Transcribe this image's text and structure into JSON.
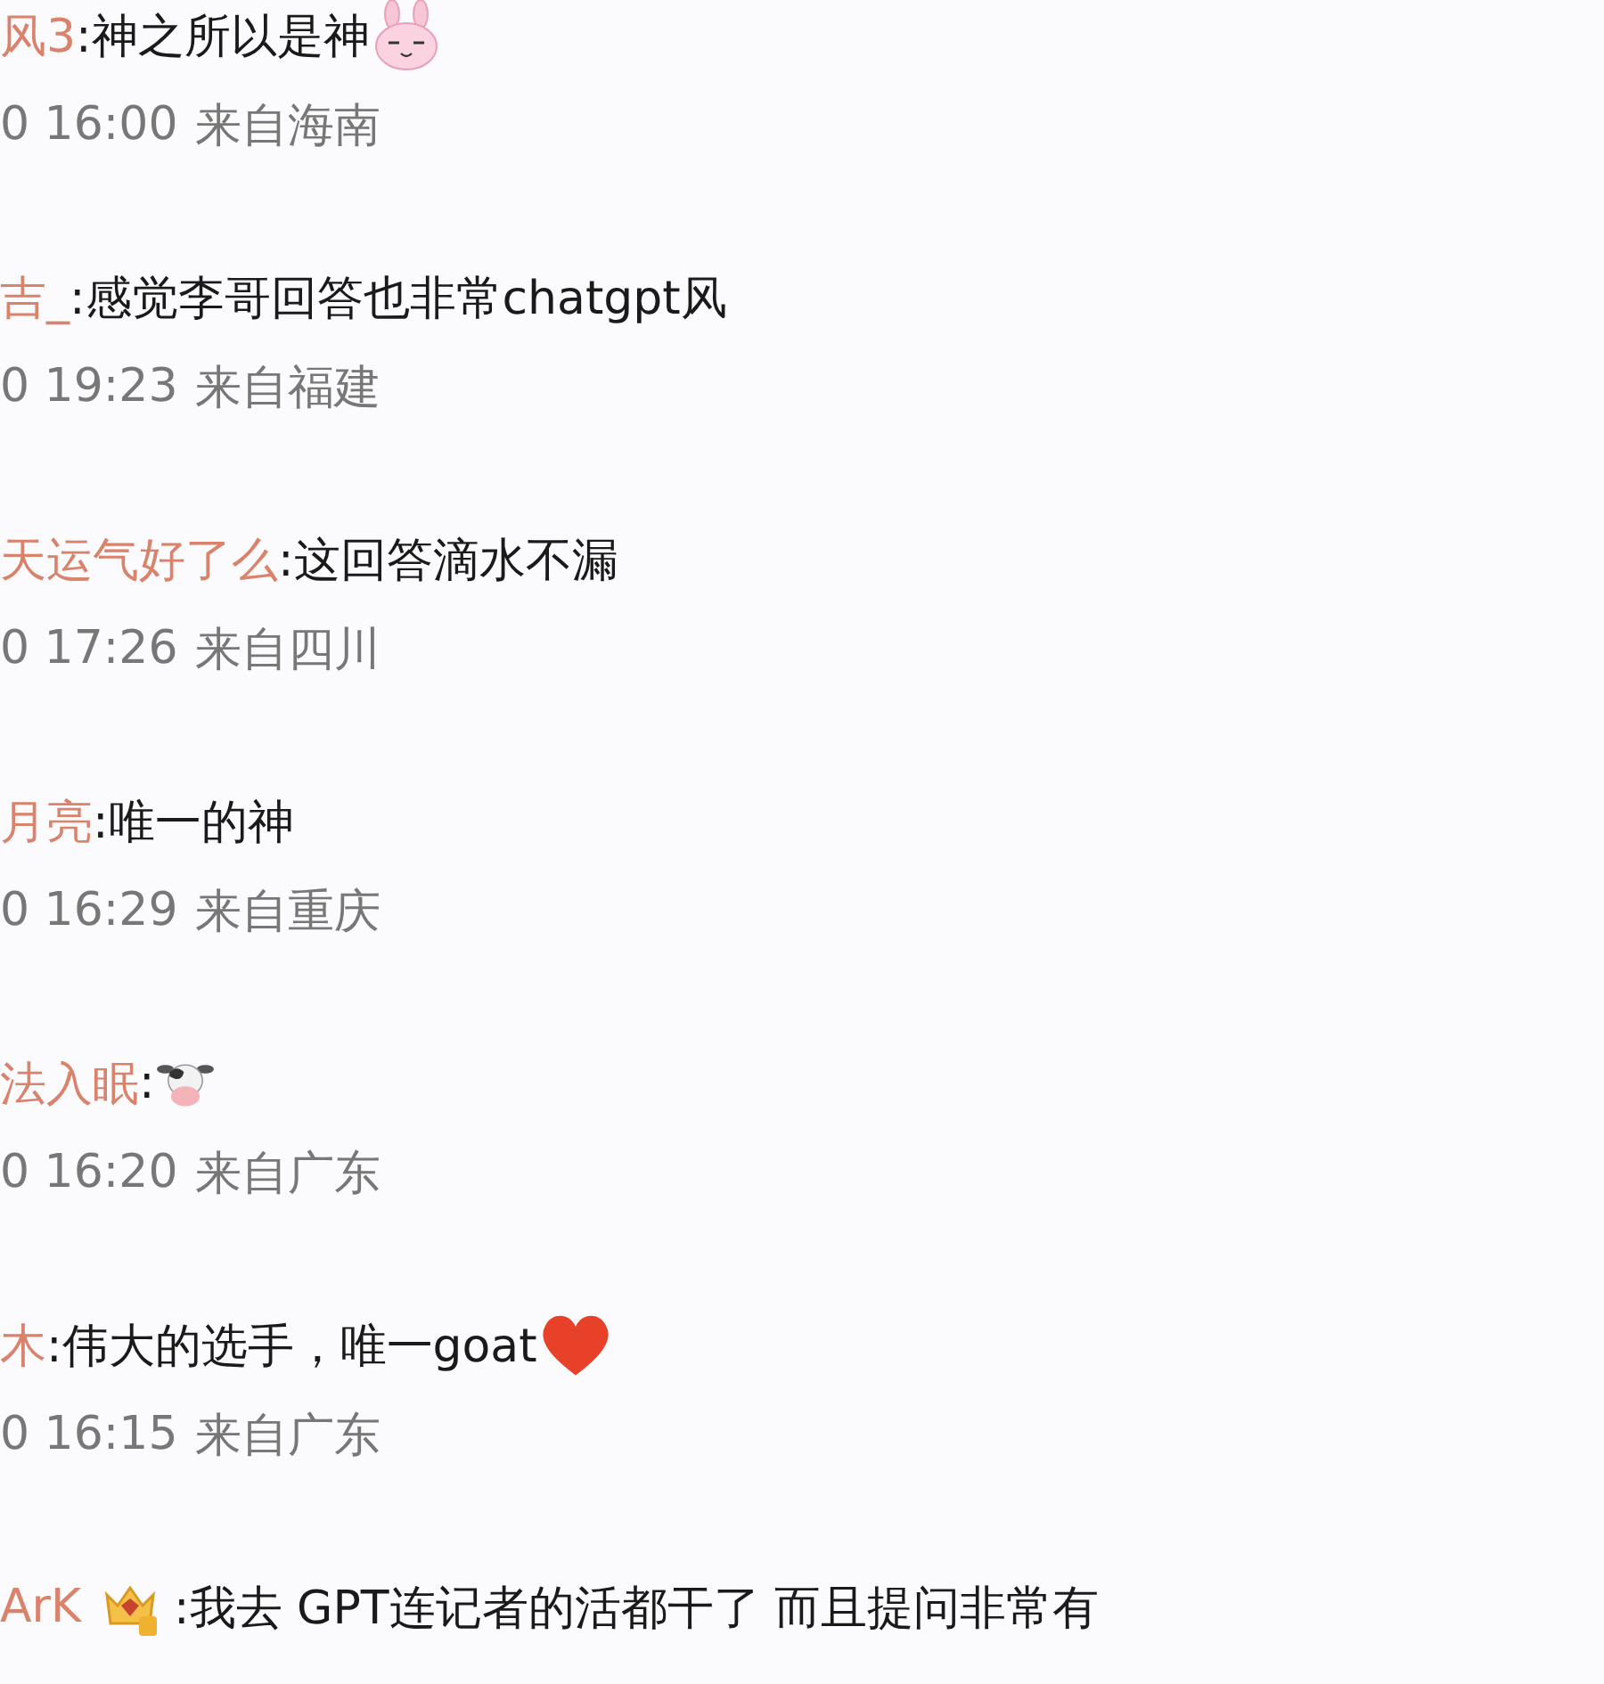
{
  "comments": [
    {
      "username": "风3",
      "parts": [
        {
          "kind": "text",
          "text": ":神之所以是神"
        },
        {
          "kind": "bunny"
        }
      ],
      "time": "0 16:00",
      "location": "来自海南"
    },
    {
      "username": "吉_",
      "parts": [
        {
          "kind": "text",
          "text": ":感觉李哥回答也非常chatgpt风"
        }
      ],
      "time": "0 19:23",
      "location": "来自福建"
    },
    {
      "username": "天运气好了么",
      "parts": [
        {
          "kind": "text",
          "text": ":这回答滴水不漏"
        }
      ],
      "time": "0 17:26",
      "location": "来自四川"
    },
    {
      "username": "月亮",
      "parts": [
        {
          "kind": "text",
          "text": ":唯一的神"
        }
      ],
      "time": "0 16:29",
      "location": "来自重庆"
    },
    {
      "username": "法入眠",
      "parts": [
        {
          "kind": "text",
          "text": ":"
        },
        {
          "kind": "cow"
        }
      ],
      "time": "0 16:20",
      "location": "来自广东"
    },
    {
      "username": "木",
      "parts": [
        {
          "kind": "text",
          "text": ":伟大的选手，唯一goat"
        },
        {
          "kind": "heart"
        }
      ],
      "time": "0 16:15",
      "location": "来自广东"
    },
    {
      "username": "ArK",
      "parts": [
        {
          "kind": "crown"
        },
        {
          "kind": "text",
          "text": ":我去 GPT连记者的活都干了 而且提问非常有"
        }
      ]
    }
  ]
}
